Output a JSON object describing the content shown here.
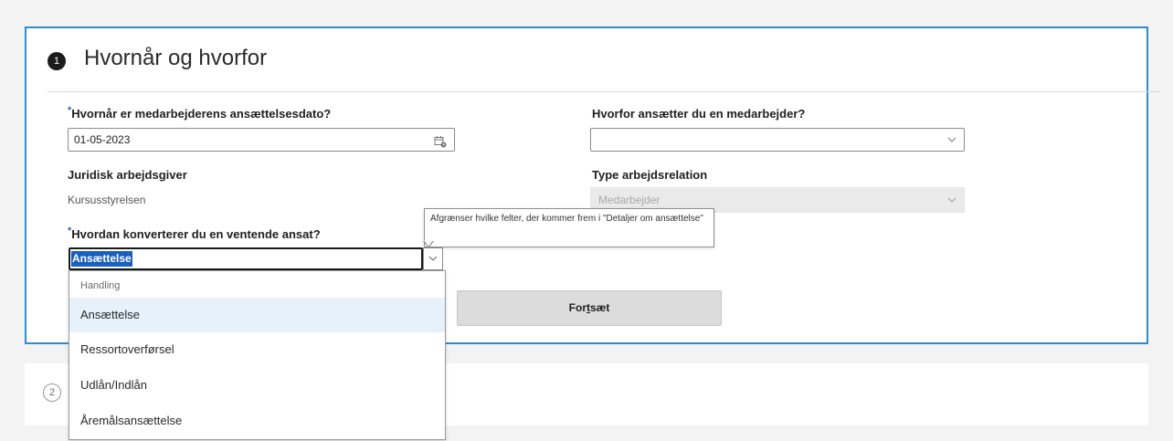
{
  "section1": {
    "step_number": "1",
    "title": "Hvornår og hvorfor",
    "hire_date": {
      "required_marker": "*",
      "label": "Hvornår er medarbejderens ansættelsesdato?",
      "value": "01-05-2023",
      "icon": "calendar-icon"
    },
    "hire_reason": {
      "label": "Hvorfor ansætter du en medarbejder?",
      "value": "",
      "icon": "chevron-down-icon"
    },
    "legal_employer": {
      "label": "Juridisk arbejdsgiver",
      "value": "Kursusstyrelsen"
    },
    "relation_type": {
      "label": "Type arbejdsrelation",
      "value": "Medarbejder"
    },
    "convert": {
      "required_marker": "*",
      "label": "Hvordan konverterer du en ventende ansat?",
      "value": "Ansættelse",
      "tooltip": "Afgrænser hvilke felter, der kommer frem i \"Detaljer om ansættelse\""
    },
    "dropdown": {
      "header": "Handling",
      "options": [
        "Ansættelse",
        "Ressortoverførsel",
        "Udlån/Indlån",
        "Åremålsansættelse"
      ],
      "selected_index": 0
    },
    "continue_button": {
      "pre": "For",
      "mnemonic": "t",
      "post": "sæt"
    }
  },
  "section2": {
    "step_number": "2"
  },
  "colors": {
    "accent": "#2d8ecb",
    "selection": "#1a5fc0",
    "option_hover": "#e6f1fa"
  }
}
